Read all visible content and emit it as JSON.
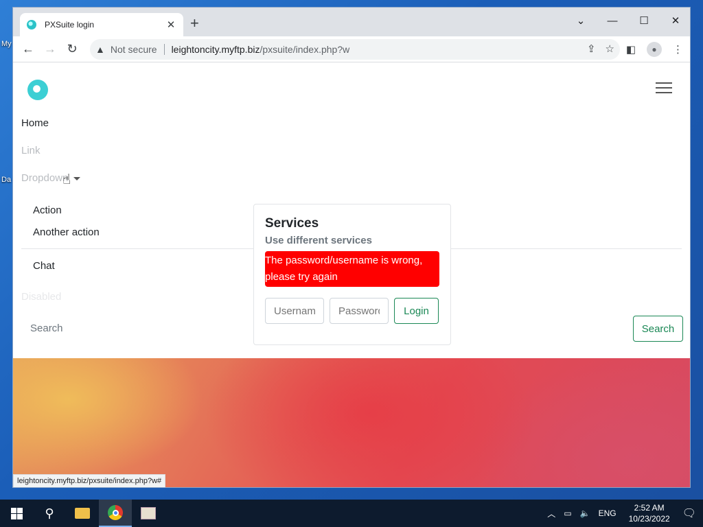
{
  "desktop": {
    "label_1": "My",
    "label_2": "Da"
  },
  "browser": {
    "tab": {
      "title": "PXSuite login",
      "close_glyph": "✕"
    },
    "new_tab_glyph": "+",
    "window_controls": [
      "⌄",
      "—",
      "☐",
      "✕"
    ],
    "address": {
      "security_label": "Not secure",
      "host": "leightoncity.myftp.biz",
      "path": "/pxsuite/index.php?w"
    },
    "status_url": "leightoncity.myftp.biz/pxsuite/index.php?w#"
  },
  "page": {
    "nav": {
      "home": "Home",
      "link": "Link",
      "dropdown": "Dropdown",
      "dropdown_items": [
        "Action",
        "Another action"
      ],
      "chat": "Chat",
      "disabled": "Disabled",
      "search_placeholder": "Search",
      "search_button": "Search"
    },
    "login_card": {
      "title": "Services",
      "subtitle": "Use different services",
      "error": "The password/username is wrong, please try again",
      "username_placeholder": "Username",
      "password_placeholder": "Password",
      "login_button": "Login"
    }
  },
  "taskbar": {
    "tray_language": "ENG",
    "time": "2:52 AM",
    "date": "10/23/2022"
  }
}
